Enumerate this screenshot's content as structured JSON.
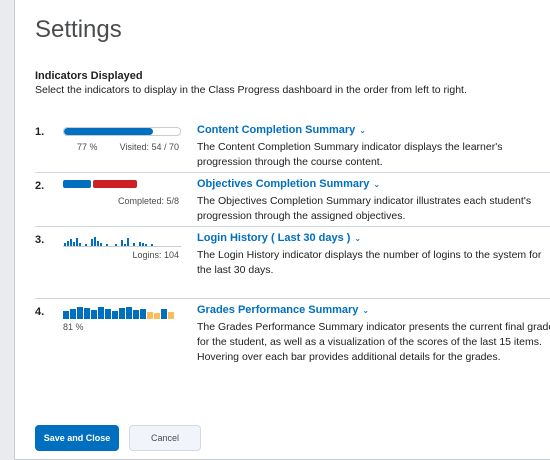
{
  "dialog": {
    "title": "Settings",
    "section_heading": "Indicators Displayed",
    "section_desc": "Select the indicators to display in the Class Progress dashboard in the order from left to right."
  },
  "indicators": [
    {
      "number": "1.",
      "title": "Content Completion Summary",
      "description": "The Content Completion Summary indicator displays the learner's progression through the course content.",
      "percent_label": "77 %",
      "visited_label": "Visited: 54 / 70",
      "progress": 0.77
    },
    {
      "number": "2.",
      "title": "Objectives Completion Summary",
      "description": "The Objectives Completion Summary indicator illustrates each student's progression through the assigned objectives.",
      "completed_label": "Completed: 5/8"
    },
    {
      "number": "3.",
      "title": "Login History ( Last 30 days )",
      "description": "The Login History indicator displays the number of logins to the system for the last 30 days.",
      "logins_label": "Logins: 104"
    },
    {
      "number": "4.",
      "title": "Grades Performance Summary",
      "description": "The Grades Performance Summary indicator presents the current final grade for the student, as well as a visualization of the scores of the last 15 items. Hovering over each bar provides additional details for the grades.",
      "grade_label": "81 %"
    }
  ],
  "buttons": {
    "save": "Save and Close",
    "cancel": "Cancel"
  },
  "colors": {
    "accent": "#006fbf",
    "objective_red": "#cd2026",
    "grade_yellow": "#ffba59"
  }
}
